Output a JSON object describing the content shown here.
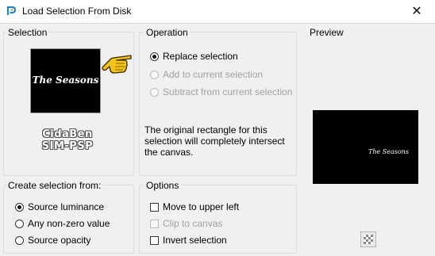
{
  "window": {
    "title": "Load Selection From Disk",
    "close_glyph": "✕"
  },
  "selection": {
    "group_title": "Selection",
    "thumbnail_text": "The Seasons",
    "watermark_line1": "CidaBen",
    "watermark_line2": "SIM-PSP"
  },
  "operation": {
    "group_title": "Operation",
    "options": [
      {
        "label": "Replace selection",
        "checked": true,
        "enabled": true
      },
      {
        "label": "Add to current selection",
        "checked": false,
        "enabled": false
      },
      {
        "label": "Subtract from current selection",
        "checked": false,
        "enabled": false
      }
    ],
    "description": "The original rectangle for this selection will completely intersect the canvas."
  },
  "preview": {
    "group_title": "Preview",
    "image_text": "The Seasons"
  },
  "create_from": {
    "group_title": "Create selection from:",
    "options": [
      {
        "label": "Source luminance",
        "checked": true
      },
      {
        "label": "Any non-zero value",
        "checked": false
      },
      {
        "label": "Source opacity",
        "checked": false
      }
    ]
  },
  "options": {
    "group_title": "Options",
    "items": [
      {
        "label": "Move to upper left",
        "checked": false,
        "enabled": true
      },
      {
        "label": "Clip to canvas",
        "checked": false,
        "enabled": false
      },
      {
        "label": "Invert selection",
        "checked": false,
        "enabled": true
      }
    ]
  },
  "icons": {
    "app": "psp-app-icon",
    "pointer": "pointing-hand-icon",
    "close": "close-icon",
    "background_toggle": "checkerboard-icon"
  }
}
